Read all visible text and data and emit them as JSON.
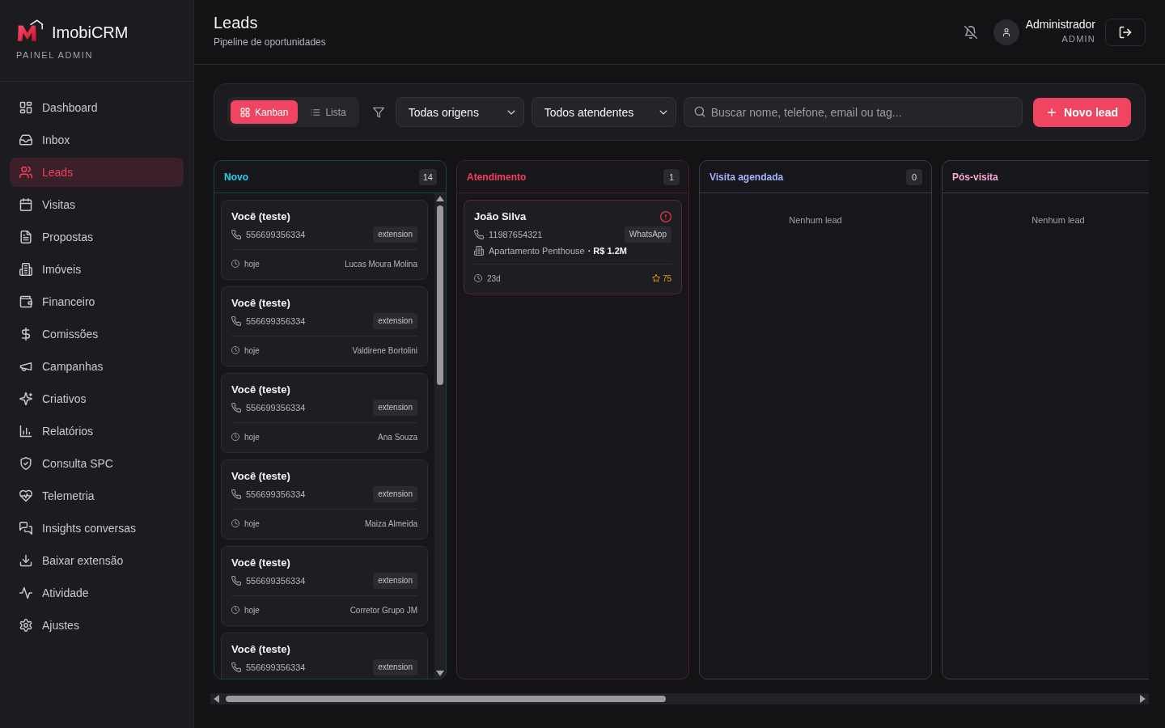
{
  "sidebar": {
    "brand": "ImobiCRM",
    "subtitle": "PAINEL ADMIN",
    "items": [
      {
        "label": "Dashboard",
        "selected": false
      },
      {
        "label": "Inbox",
        "selected": false
      },
      {
        "label": "Leads",
        "selected": true
      },
      {
        "label": "Visitas",
        "selected": false
      },
      {
        "label": "Propostas",
        "selected": false
      },
      {
        "label": "Imóveis",
        "selected": false
      },
      {
        "label": "Financeiro",
        "selected": false
      },
      {
        "label": "Comissões",
        "selected": false
      },
      {
        "label": "Campanhas",
        "selected": false
      },
      {
        "label": "Criativos",
        "selected": false
      },
      {
        "label": "Relatórios",
        "selected": false
      },
      {
        "label": "Consulta SPC",
        "selected": false
      },
      {
        "label": "Telemetria",
        "selected": false
      },
      {
        "label": "Insights conversas",
        "selected": false
      },
      {
        "label": "Baixar extensão",
        "selected": false
      },
      {
        "label": "Atividade",
        "selected": false
      },
      {
        "label": "Ajustes",
        "selected": false
      }
    ]
  },
  "header": {
    "title": "Leads",
    "subtitle": "Pipeline de oportunidades",
    "user": {
      "name": "Administrador",
      "role": "ADMIN"
    }
  },
  "toolbar": {
    "views": [
      {
        "label": "Kanban",
        "selected": true
      },
      {
        "label": "Lista",
        "selected": false
      }
    ],
    "filters": [
      {
        "value": "Todas origens"
      },
      {
        "value": "Todos atendentes"
      }
    ],
    "search": {
      "placeholder": "Buscar nome, telefone, email ou tag..."
    },
    "new_lead_button": "Novo lead"
  },
  "columns": [
    {
      "title": "Novo",
      "color": "#22d3ee",
      "count": "14",
      "cards": [
        {
          "name": "Você (teste)",
          "alert": false,
          "phone": "556699356334",
          "source": "extension",
          "age": "hoje",
          "agent": "Lucas Moura Molina"
        },
        {
          "name": "Você (teste)",
          "alert": false,
          "phone": "556699356334",
          "source": "extension",
          "age": "hoje",
          "agent": "Valdirene Bortolini"
        },
        {
          "name": "Você (teste)",
          "alert": false,
          "phone": "556699356334",
          "source": "extension",
          "age": "hoje",
          "agent": "Ana Souza"
        },
        {
          "name": "Você (teste)",
          "alert": false,
          "phone": "556699356334",
          "source": "extension",
          "age": "hoje",
          "agent": "Maiza Almeida"
        },
        {
          "name": "Você (teste)",
          "alert": false,
          "phone": "556699356334",
          "source": "extension",
          "age": "hoje",
          "agent": "Corretor Grupo JM"
        },
        {
          "name": "Você (teste)",
          "alert": false,
          "phone": "556699356334",
          "source": "extension"
        }
      ]
    },
    {
      "title": "Atendimento",
      "color": "#f43f5e",
      "count": "1",
      "cards": [
        {
          "name": "João Silva",
          "alert": true,
          "phone": "11987654321",
          "source": "WhatsApp",
          "property": "Apartamento Penthouse",
          "price": "· R$ 1.2M",
          "age": "23d",
          "score": "75"
        }
      ]
    },
    {
      "title": "Visita agendada",
      "color": "#a5b4fc",
      "count": "0",
      "empty_text": "Nenhum lead"
    },
    {
      "title": "Pós-visita",
      "color": "#f9a8d4",
      "empty_text": "Nenhum lead"
    }
  ]
}
